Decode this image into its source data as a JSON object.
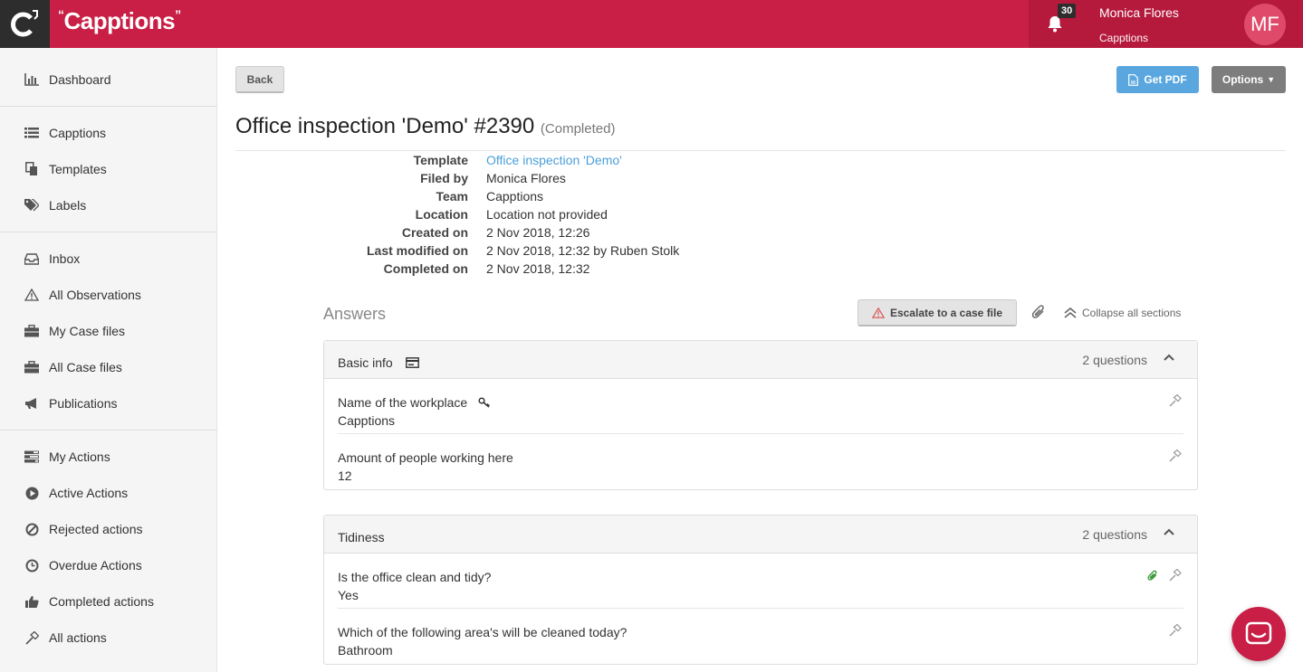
{
  "header": {
    "brand": "Capptions",
    "notification_count": "30",
    "user_name": "Monica Flores",
    "user_team": "Capptions",
    "avatar_initials": "MF",
    "brand_color": "#c91e45"
  },
  "sidebar": {
    "items": [
      {
        "label": "Dashboard",
        "icon": "bar-chart-icon"
      },
      {
        "label": "Capptions",
        "icon": "list-icon"
      },
      {
        "label": "Templates",
        "icon": "copy-icon"
      },
      {
        "label": "Labels",
        "icon": "tags-icon"
      },
      {
        "label": "Inbox",
        "icon": "inbox-icon"
      },
      {
        "label": "All Observations",
        "icon": "warning-icon"
      },
      {
        "label": "My Case files",
        "icon": "briefcase-icon"
      },
      {
        "label": "All Case files",
        "icon": "briefcase-icon"
      },
      {
        "label": "Publications",
        "icon": "bullhorn-icon"
      },
      {
        "label": "My Actions",
        "icon": "tasks-icon"
      },
      {
        "label": "Active Actions",
        "icon": "play-circle-icon"
      },
      {
        "label": "Rejected actions",
        "icon": "ban-icon"
      },
      {
        "label": "Overdue Actions",
        "icon": "clock-icon"
      },
      {
        "label": "Completed actions",
        "icon": "thumbs-up-icon"
      },
      {
        "label": "All actions",
        "icon": "hammer-icon"
      }
    ]
  },
  "toolbar": {
    "back_label": "Back",
    "pdf_label": "Get PDF",
    "options_label": "Options"
  },
  "page": {
    "title": "Office inspection 'Demo' #2390",
    "status": "(Completed)"
  },
  "meta": {
    "template_label": "Template",
    "template_value": "Office inspection 'Demo'",
    "filed_by_label": "Filed by",
    "filed_by_value": "Monica Flores",
    "team_label": "Team",
    "team_value": "Capptions",
    "location_label": "Location",
    "location_value": "Location not provided",
    "created_label": "Created on",
    "created_value": "2 Nov 2018, 12:26",
    "modified_label": "Last modified on",
    "modified_value": "2 Nov 2018, 12:32 by Ruben Stolk",
    "completed_label": "Completed on",
    "completed_value": "2 Nov 2018, 12:32"
  },
  "answers": {
    "heading": "Answers",
    "escalate_label": "Escalate to a case file",
    "collapse_label": "Collapse all sections",
    "sections": [
      {
        "title": "Basic info",
        "count": "2 questions",
        "questions": [
          {
            "label": "Name of the workplace",
            "value": "Capptions"
          },
          {
            "label": "Amount of people working here",
            "value": "12"
          }
        ]
      },
      {
        "title": "Tidiness",
        "count": "2 questions",
        "questions": [
          {
            "label": "Is the office clean and tidy?",
            "value": "Yes"
          },
          {
            "label": "Which of the following area's will be cleaned today?",
            "value": "Bathroom"
          }
        ]
      }
    ]
  }
}
